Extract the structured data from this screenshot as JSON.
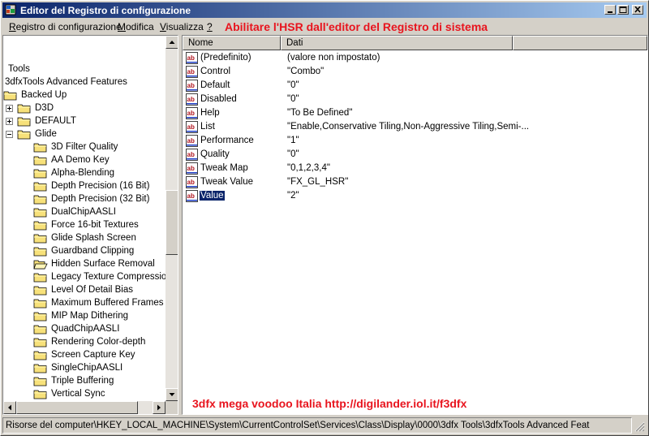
{
  "window": {
    "title": "Editor del Registro di configurazione",
    "app_icon": "regedit-icon"
  },
  "menu": {
    "items": [
      {
        "pre": "",
        "acc": "R",
        "post": "egistro di configurazione"
      },
      {
        "pre": "",
        "acc": "M",
        "post": "odifica"
      },
      {
        "pre": "",
        "acc": "V",
        "post": "isualizza"
      },
      {
        "pre": "",
        "acc": "?",
        "post": ""
      }
    ]
  },
  "annotations": {
    "top": "Abilitare l'HSR dall'editor del Registro di sistema",
    "bottom": "3dfx mega voodoo Italia  http://digilander.iol.it/f3dfx"
  },
  "tree": {
    "items": [
      {
        "label": "Tools",
        "folder": false,
        "expander": ""
      },
      {
        "label": "3dfxTools Advanced Features",
        "folder": false,
        "expander": ""
      },
      {
        "label": "Backed Up",
        "folder": true,
        "expander": ""
      },
      {
        "label": "D3D",
        "folder": true,
        "expander": "+"
      },
      {
        "label": "DEFAULT",
        "folder": true,
        "expander": "+"
      },
      {
        "label": "Glide",
        "folder": true,
        "expander": "-"
      },
      {
        "label": "3D Filter Quality",
        "folder": true,
        "expander": ""
      },
      {
        "label": "AA Demo Key",
        "folder": true,
        "expander": ""
      },
      {
        "label": "Alpha-Blending",
        "folder": true,
        "expander": ""
      },
      {
        "label": "Depth Precision (16 Bit)",
        "folder": true,
        "expander": ""
      },
      {
        "label": "Depth Precision (32 Bit)",
        "folder": true,
        "expander": ""
      },
      {
        "label": "DualChipAASLI",
        "folder": true,
        "expander": ""
      },
      {
        "label": "Force 16-bit Textures",
        "folder": true,
        "expander": ""
      },
      {
        "label": "Glide Splash Screen",
        "folder": true,
        "expander": ""
      },
      {
        "label": "Guardband Clipping",
        "folder": true,
        "expander": ""
      },
      {
        "label": "Hidden Surface Removal",
        "folder": true,
        "expander": "",
        "open": true
      },
      {
        "label": "Legacy Texture Compression",
        "folder": true,
        "expander": ""
      },
      {
        "label": "Level Of Detail Bias",
        "folder": true,
        "expander": ""
      },
      {
        "label": "Maximum Buffered Frames",
        "folder": true,
        "expander": ""
      },
      {
        "label": "MIP Map Dithering",
        "folder": true,
        "expander": ""
      },
      {
        "label": "QuadChipAASLI",
        "folder": true,
        "expander": ""
      },
      {
        "label": "Rendering Color-depth",
        "folder": true,
        "expander": ""
      },
      {
        "label": "Screen Capture Key",
        "folder": true,
        "expander": ""
      },
      {
        "label": "SingleChipAASLI",
        "folder": true,
        "expander": ""
      },
      {
        "label": "Triple Buffering",
        "folder": true,
        "expander": ""
      },
      {
        "label": "Vertical Sync",
        "folder": true,
        "expander": ""
      }
    ]
  },
  "list": {
    "columns": [
      "Nome",
      "Dati"
    ],
    "rows": [
      {
        "name": "(Predefinito)",
        "data": "(valore non impostato)"
      },
      {
        "name": "Control",
        "data": "\"Combo\""
      },
      {
        "name": "Default",
        "data": "\"0\""
      },
      {
        "name": "Disabled",
        "data": "\"0\""
      },
      {
        "name": "Help",
        "data": "\"To Be Defined\""
      },
      {
        "name": "List",
        "data": "\"Enable,Conservative Tiling,Non-Aggressive Tiling,Semi-..."
      },
      {
        "name": "Performance",
        "data": "\"1\""
      },
      {
        "name": "Quality",
        "data": "\"0\""
      },
      {
        "name": "Tweak Map",
        "data": "\"0,1,2,3,4\""
      },
      {
        "name": "Tweak Value",
        "data": "\"FX_GL_HSR\""
      },
      {
        "name": "Value",
        "data": "\"2\"",
        "selected": true
      }
    ],
    "row_icon": "string-value-icon"
  },
  "status": {
    "path": "Risorse del computer\\HKEY_LOCAL_MACHINE\\System\\CurrentControlSet\\Services\\Class\\Display\\0000\\3dfx Tools\\3dfxTools Advanced Feat"
  },
  "colors": {
    "title_start": "#0a246a",
    "title_end": "#a6caf0",
    "annotation": "#e8141e",
    "selection": "#0a246a",
    "folder": "#f7e17a"
  }
}
